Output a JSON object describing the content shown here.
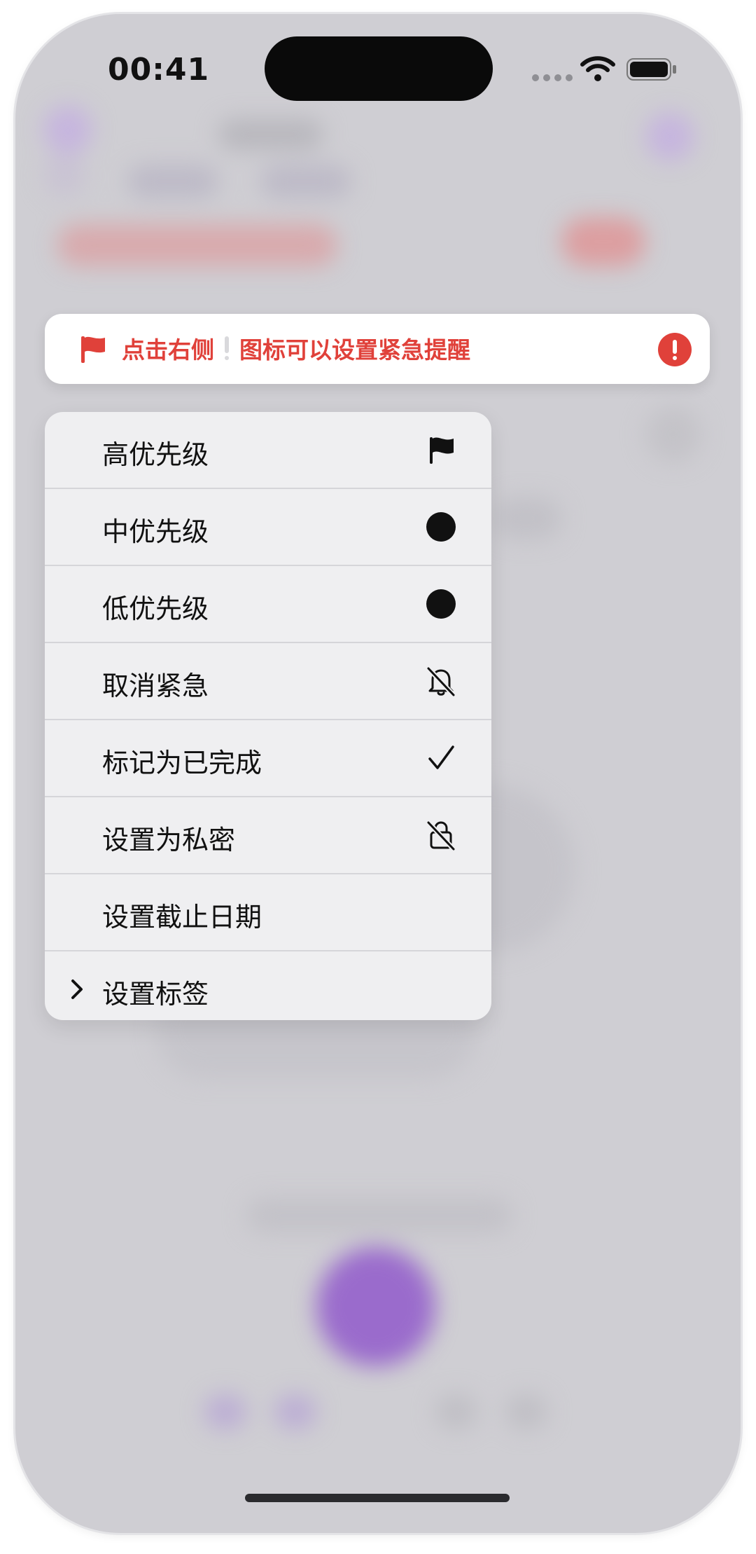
{
  "status_bar": {
    "time": "00:41"
  },
  "banner": {
    "text_before": "点击右侧",
    "text_after": "图标可以设置紧急提醒",
    "flag_icon": "flag-icon",
    "alert_icon": "exclamation-circle-icon",
    "accent_color": "#e0413a"
  },
  "menu": {
    "items": [
      {
        "label": "高优先级",
        "icon": "flag-fill-icon"
      },
      {
        "label": "中优先级",
        "icon": "circle-fill-icon"
      },
      {
        "label": "低优先级",
        "icon": "circle-fill-icon"
      },
      {
        "label": "取消紧急",
        "icon": "bell-slash-icon"
      },
      {
        "label": "标记为已完成",
        "icon": "checkmark-icon"
      },
      {
        "label": "设置为私密",
        "icon": "lock-slash-icon"
      },
      {
        "label": "设置截止日期",
        "icon": ""
      },
      {
        "label": "设置标签",
        "icon": "chevron-right-icon"
      }
    ]
  },
  "colors": {
    "backdrop": "#cfced3",
    "menu_bg": "#efeff1",
    "accent_purple": "#9b6bd1"
  }
}
